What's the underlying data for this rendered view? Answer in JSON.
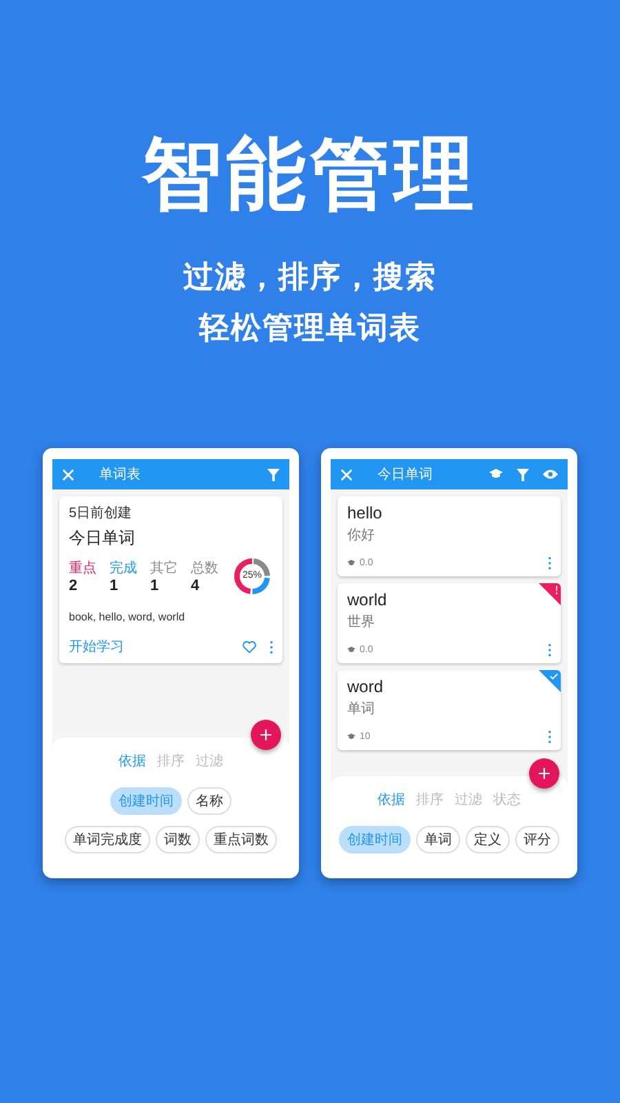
{
  "headline": "智能管理",
  "subtitle_lines": [
    "过滤，排序，搜索",
    "轻松管理单词表"
  ],
  "left_screen": {
    "title": "单词表",
    "card": {
      "created": "5日前创建",
      "title": "今日单词",
      "stats": [
        {
          "kind": "part",
          "label": "重点",
          "value": "2",
          "color": "#e91e63"
        },
        {
          "kind": "part",
          "label": "完成",
          "value": "1",
          "color": "#2196f3"
        },
        {
          "kind": "part",
          "label": "其它",
          "value": "1",
          "color": "#8a8a8a"
        },
        {
          "kind": "total",
          "label": "总数",
          "value": "4",
          "color": "#8a8a8a"
        }
      ],
      "progress_label": "25%",
      "words": "book, hello, word, world",
      "action": "开始学习",
      "favorite": false
    },
    "sheet": {
      "tabs": [
        {
          "label": "依据",
          "selected": true
        },
        {
          "label": "排序",
          "selected": false
        },
        {
          "label": "过滤",
          "selected": false
        }
      ],
      "chip_rows": [
        [
          {
            "label": "创建时间",
            "selected": true
          },
          {
            "label": "名称",
            "selected": false
          }
        ],
        [
          {
            "label": "单词完成度",
            "selected": false
          },
          {
            "label": "词数",
            "selected": false
          },
          {
            "label": "重点词数",
            "selected": false
          }
        ]
      ]
    }
  },
  "right_screen": {
    "title": "今日单词",
    "words": [
      {
        "word": "hello",
        "meaning": "你好",
        "rating": "0.0",
        "important": false,
        "done": false
      },
      {
        "word": "world",
        "meaning": "世界",
        "rating": "0.0",
        "important": true,
        "done": false
      },
      {
        "word": "word",
        "meaning": "单词",
        "rating": "10",
        "important": false,
        "done": true
      }
    ],
    "sheet": {
      "tabs": [
        {
          "label": "依据",
          "selected": true
        },
        {
          "label": "排序",
          "selected": false
        },
        {
          "label": "过滤",
          "selected": false
        },
        {
          "label": "状态",
          "selected": false
        }
      ],
      "chip_rows": [
        [
          {
            "label": "创建时间",
            "selected": true
          },
          {
            "label": "单词",
            "selected": false
          },
          {
            "label": "定义",
            "selected": false
          },
          {
            "label": "评分",
            "selected": false
          }
        ]
      ]
    }
  }
}
